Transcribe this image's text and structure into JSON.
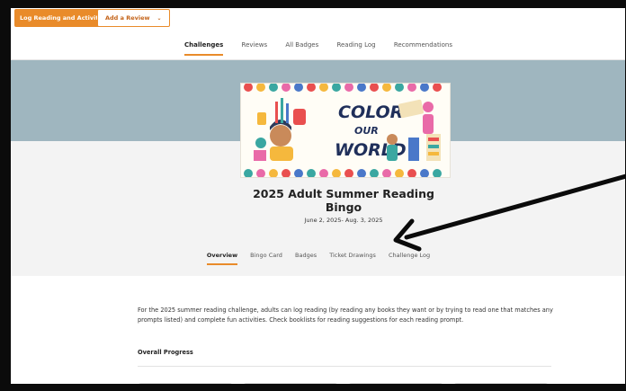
{
  "toolbar": {
    "log_button": "Log Reading and Activities",
    "review_button": "Add a Review",
    "review_chevron": "⌄"
  },
  "top_nav": {
    "tabs": [
      "Challenges",
      "Reviews",
      "All Badges",
      "Reading Log",
      "Recommendations"
    ],
    "active": "Challenges"
  },
  "banner": {
    "line1": "COLOR",
    "line2": "OUR",
    "line3": "WORLD"
  },
  "challenge": {
    "title_line1": "2025 Adult Summer Reading",
    "title_line2": "Bingo",
    "dates": "June 2, 2025- Aug. 3, 2025"
  },
  "sub_nav": {
    "tabs": [
      "Overview",
      "Bingo Card",
      "Badges",
      "Ticket Drawings",
      "Challenge Log"
    ],
    "active": "Overview"
  },
  "description": "For the 2025 summer reading challenge, adults can log reading (by reading any books they want or by trying to read one that matches any prompts listed) and complete fun activities. Check booklists for reading suggestions for each reading prompt.",
  "progress": {
    "title": "Overall Progress"
  },
  "colors": {
    "accent": "#e98b2a",
    "hero": "#9fb6bf",
    "annotation": "#000000"
  }
}
